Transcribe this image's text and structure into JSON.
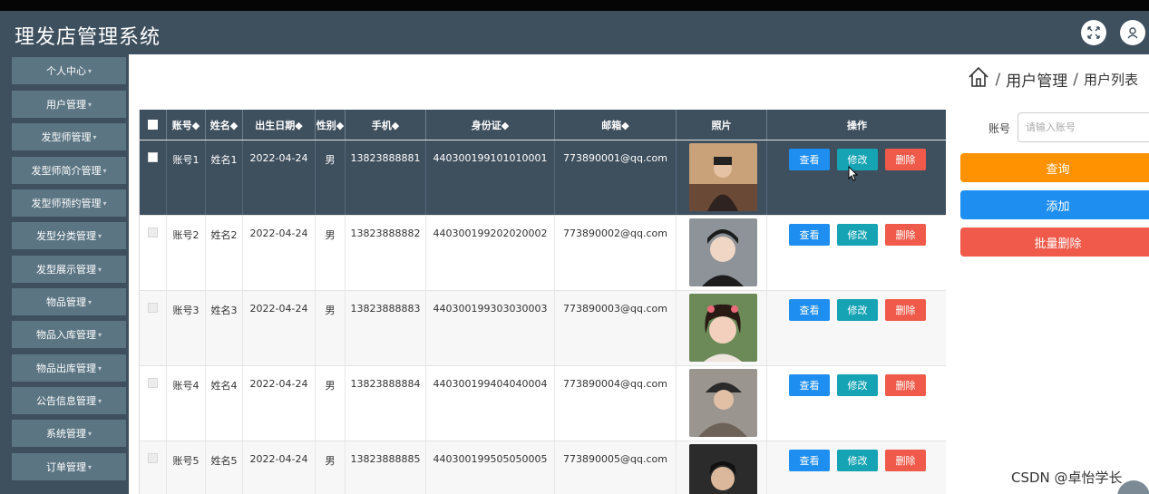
{
  "header": {
    "title": "理发店管理系统",
    "icons": [
      "fullscreen-icon",
      "user-icon"
    ]
  },
  "sidebar": {
    "items": [
      {
        "label": "个人中心"
      },
      {
        "label": "用户管理"
      },
      {
        "label": "发型师管理"
      },
      {
        "label": "发型师简介管理"
      },
      {
        "label": "发型师预约管理"
      },
      {
        "label": "发型分类管理"
      },
      {
        "label": "发型展示管理"
      },
      {
        "label": "物品管理"
      },
      {
        "label": "物品入库管理"
      },
      {
        "label": "物品出库管理"
      },
      {
        "label": "公告信息管理"
      },
      {
        "label": "系统管理"
      },
      {
        "label": "订单管理"
      }
    ],
    "caret": "▾"
  },
  "breadcrumb": {
    "home_icon": "home-icon",
    "sep": "/",
    "level1": "用户管理",
    "level2": "用户列表"
  },
  "table": {
    "headers": {
      "account": "账号◆",
      "name": "姓名◆",
      "birth": "出生日期◆",
      "gender": "性别◆",
      "phone": "手机◆",
      "idcard": "身份证◆",
      "email": "邮箱◆",
      "photo": "照片",
      "ops": "操作"
    },
    "rows": [
      {
        "account": "账号1",
        "name": "姓名1",
        "birth": "2022-04-24",
        "gender": "男",
        "phone": "13823888881",
        "idcard": "440300199101010001",
        "email": "773890001@qq.com"
      },
      {
        "account": "账号2",
        "name": "姓名2",
        "birth": "2022-04-24",
        "gender": "男",
        "phone": "13823888882",
        "idcard": "440300199202020002",
        "email": "773890002@qq.com"
      },
      {
        "account": "账号3",
        "name": "姓名3",
        "birth": "2022-04-24",
        "gender": "男",
        "phone": "13823888883",
        "idcard": "440300199303030003",
        "email": "773890003@qq.com"
      },
      {
        "account": "账号4",
        "name": "姓名4",
        "birth": "2022-04-24",
        "gender": "男",
        "phone": "13823888884",
        "idcard": "440300199404040004",
        "email": "773890004@qq.com"
      },
      {
        "account": "账号5",
        "name": "姓名5",
        "birth": "2022-04-24",
        "gender": "男",
        "phone": "13823888885",
        "idcard": "440300199505050005",
        "email": "773890005@qq.com"
      }
    ],
    "btn_view": "查看",
    "btn_edit": "修改",
    "btn_delete": "删除"
  },
  "search": {
    "label": "账号",
    "placeholder": "请输入账号"
  },
  "actions": {
    "query": "查询",
    "add": "添加",
    "batch_delete": "批量删除"
  },
  "watermark": "CSDN @卓怡学长",
  "colors": {
    "header_bg": "#3e4f5e",
    "sidebar_item": "#5b7583",
    "query": "#ff9200",
    "add": "#1e8ef0",
    "batch_delete": "#f05a4a",
    "edit": "#16a3b3"
  }
}
